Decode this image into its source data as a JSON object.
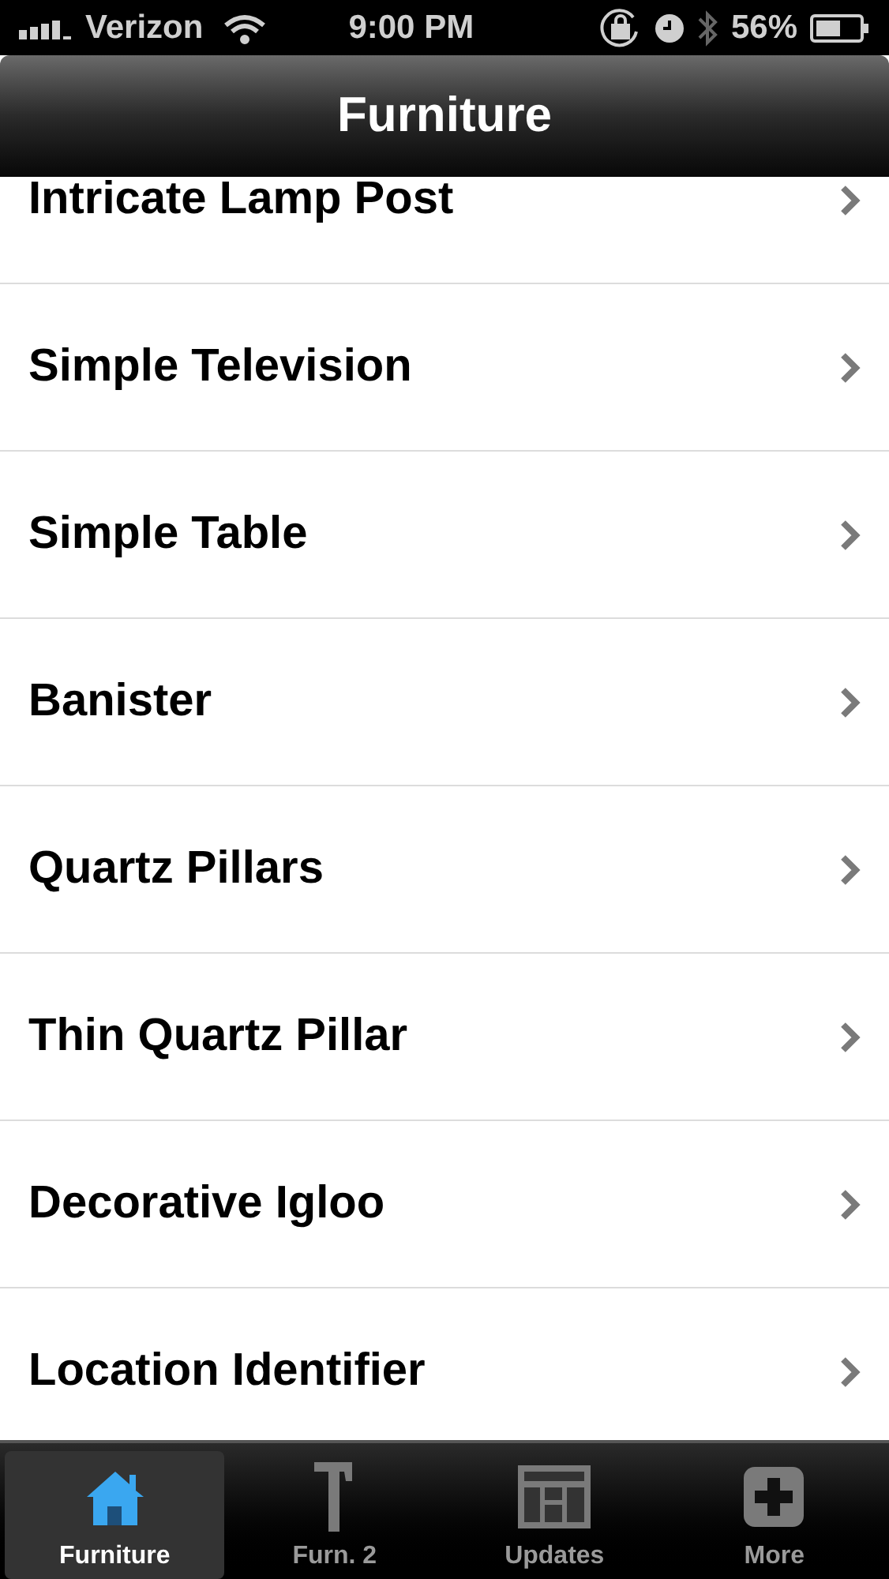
{
  "status_bar": {
    "carrier": "Verizon",
    "time": "9:00 PM",
    "battery": "56%"
  },
  "nav_bar": {
    "title": "Furniture"
  },
  "list": [
    {
      "label": "Intricate Lamp Post"
    },
    {
      "label": "Simple Television"
    },
    {
      "label": "Simple Table"
    },
    {
      "label": "Banister"
    },
    {
      "label": "Quartz Pillars"
    },
    {
      "label": "Thin Quartz Pillar"
    },
    {
      "label": "Decorative Igloo"
    },
    {
      "label": "Location Identifier"
    }
  ],
  "tab_bar": [
    {
      "label": "Furniture",
      "kind": "house",
      "selected": true
    },
    {
      "label": "Furn. 2",
      "kind": "hammer",
      "selected": false
    },
    {
      "label": "Updates",
      "kind": "newspaper",
      "selected": false
    },
    {
      "label": "More",
      "kind": "plus",
      "selected": false
    }
  ]
}
